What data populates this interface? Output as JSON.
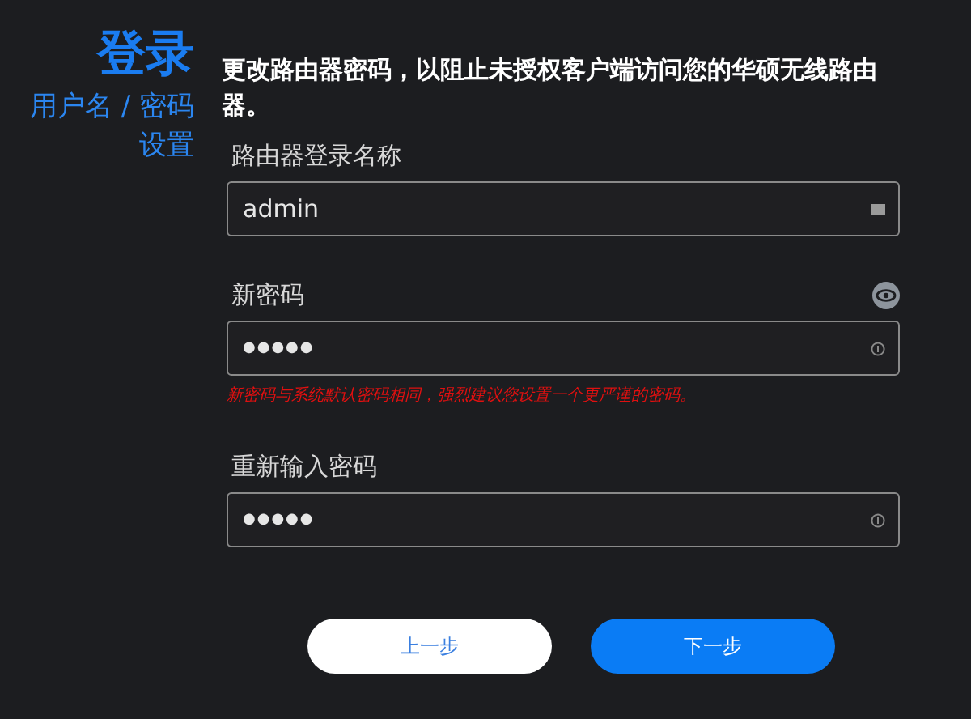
{
  "sidebar": {
    "title": "登录",
    "subtitle": "用户名 / 密码设置"
  },
  "heading": "更改路由器密码，以阻止未授权客户端访问您的华硕无线路由器。",
  "fields": [
    {
      "kind": "text",
      "label": "路由器登录名称",
      "value": "admin"
    },
    {
      "kind": "password",
      "label": "新密码",
      "value": "●●●●●",
      "reveal_toggle": true,
      "warning": "新密码与系统默认密码相同，强烈建议您设置一个更严谨的密码。"
    },
    {
      "kind": "password",
      "label": "重新输入密码",
      "value": "●●●●●"
    }
  ],
  "buttons": [
    {
      "label": "上一步",
      "kind": "secondary"
    },
    {
      "label": "下一步",
      "kind": "primary"
    }
  ]
}
